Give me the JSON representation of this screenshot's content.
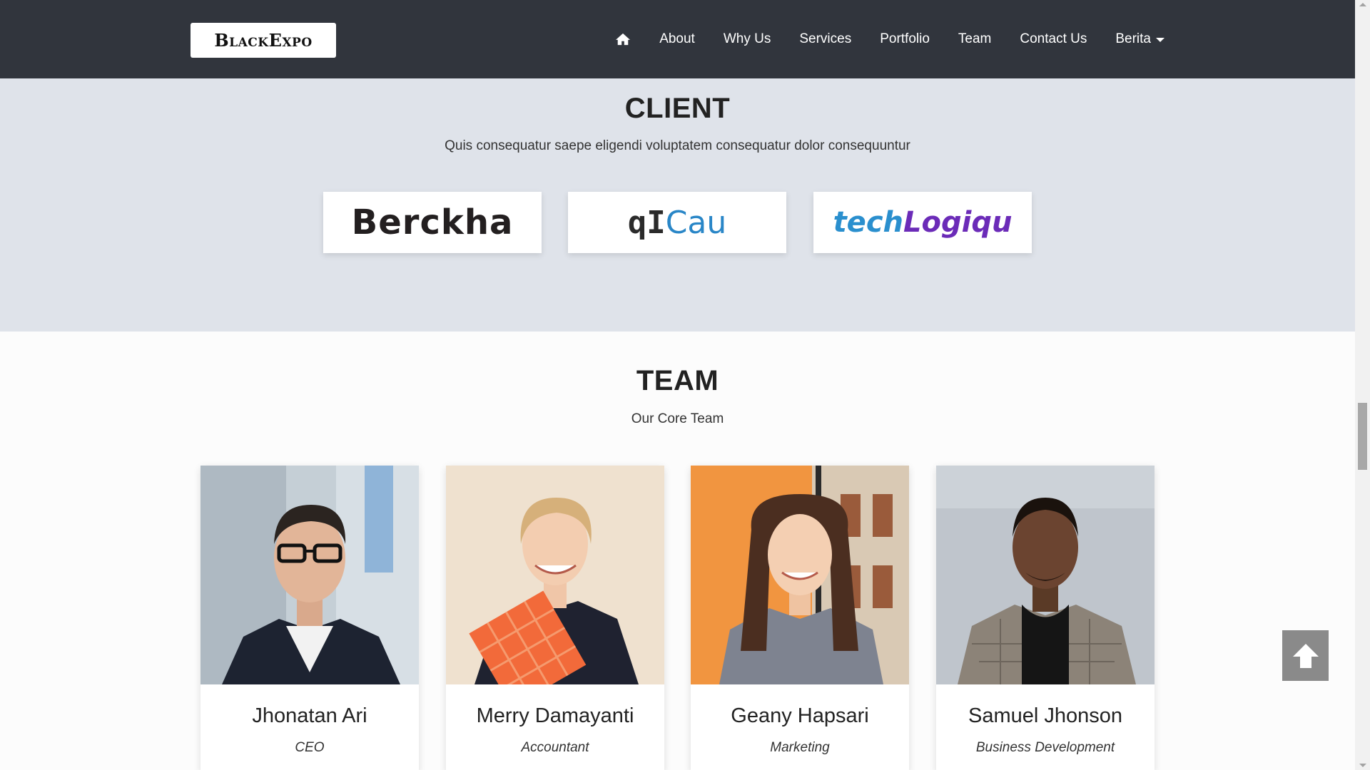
{
  "brand": {
    "logo_text": "BlackExpo"
  },
  "nav": {
    "home_icon": "home-icon",
    "items": [
      "About",
      "Why Us",
      "Services",
      "Portfolio",
      "Team",
      "Contact Us"
    ],
    "dropdown_label": "Berita"
  },
  "client": {
    "title": "CLIENT",
    "subtitle": "Quis consequatur saepe eligendi voluptatem consequatur dolor consequuntur",
    "logos": {
      "berckha": "Berckha",
      "qicau_part1": "qI",
      "qicau_part2": "Cau",
      "tech_part1": "tech",
      "tech_part2": "Logiqu"
    }
  },
  "team": {
    "title": "TEAM",
    "subtitle": "Our Core Team",
    "members": [
      {
        "name": "Jhonatan Ari",
        "role": "CEO"
      },
      {
        "name": "Merry Damayanti",
        "role": "Accountant"
      },
      {
        "name": "Geany Hapsari",
        "role": "Marketing"
      },
      {
        "name": "Samuel Jhonson",
        "role": "Business Development"
      }
    ]
  },
  "colors": {
    "navbar": "#31353d",
    "client_bg": "#dfe3ea",
    "page_bg": "#fcfcfc",
    "back_to_top": "#8a8a8a"
  },
  "icons": {
    "back_to_top": "arrow-up-icon"
  }
}
